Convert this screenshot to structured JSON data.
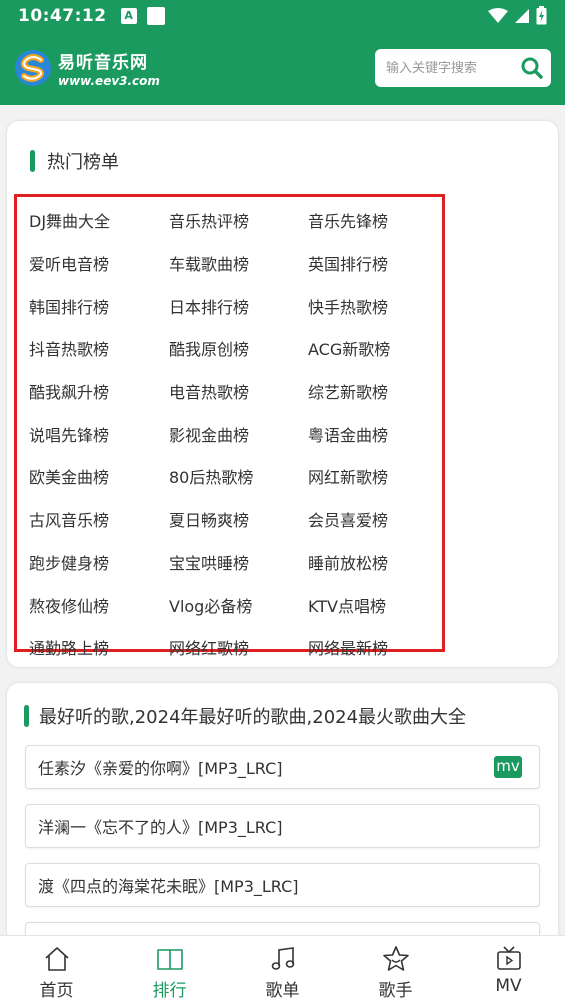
{
  "status_bar": {
    "time": "10:47:12",
    "icon_a": "A",
    "icons": [
      "wifi-icon",
      "signal-icon",
      "battery-icon"
    ]
  },
  "header": {
    "logo_title": "易听音乐网",
    "logo_url": "www.eev3.com",
    "search_placeholder": "输入关键字搜索"
  },
  "hot_charts": {
    "title": "热门榜单",
    "items": [
      "DJ舞曲大全",
      "音乐热评榜",
      "音乐先锋榜",
      "爱听电音榜",
      "车载歌曲榜",
      "英国排行榜",
      "韩国排行榜",
      "日本排行榜",
      "快手热歌榜",
      "抖音热歌榜",
      "酷我原创榜",
      "ACG新歌榜",
      "酷我飙升榜",
      "电音热歌榜",
      "综艺新歌榜",
      "说唱先锋榜",
      "影视金曲榜",
      "粤语金曲榜",
      "欧美金曲榜",
      "80后热歌榜",
      "网红新歌榜",
      "古风音乐榜",
      "夏日畅爽榜",
      "会员喜爱榜",
      "跑步健身榜",
      "宝宝哄睡榜",
      "睡前放松榜",
      "熬夜修仙榜",
      "Vlog必备榜",
      "KTV点唱榜",
      "通勤路上榜",
      "网络红歌榜",
      "网络最新榜"
    ]
  },
  "best_songs": {
    "title": "最好听的歌,2024年最好听的歌曲,2024最火歌曲大全",
    "songs": [
      {
        "title": "任素汐《亲爱的你啊》[MP3_LRC]",
        "badge": "mv"
      },
      {
        "title": "洋澜一《忘不了的人》[MP3_LRC]",
        "badge": ""
      },
      {
        "title": "渡《四点的海棠花未眠》[MP3_LRC]",
        "badge": ""
      }
    ]
  },
  "tabbar": {
    "tabs": [
      {
        "label": "首页",
        "icon": "home-icon"
      },
      {
        "label": "排行",
        "icon": "book-icon",
        "active": true
      },
      {
        "label": "歌单",
        "icon": "music-note-icon"
      },
      {
        "label": "歌手",
        "icon": "star-icon"
      },
      {
        "label": "MV",
        "icon": "tv-icon"
      }
    ]
  },
  "colors": {
    "brand": "#1a9a5f",
    "highlight_box": "#e02020"
  }
}
